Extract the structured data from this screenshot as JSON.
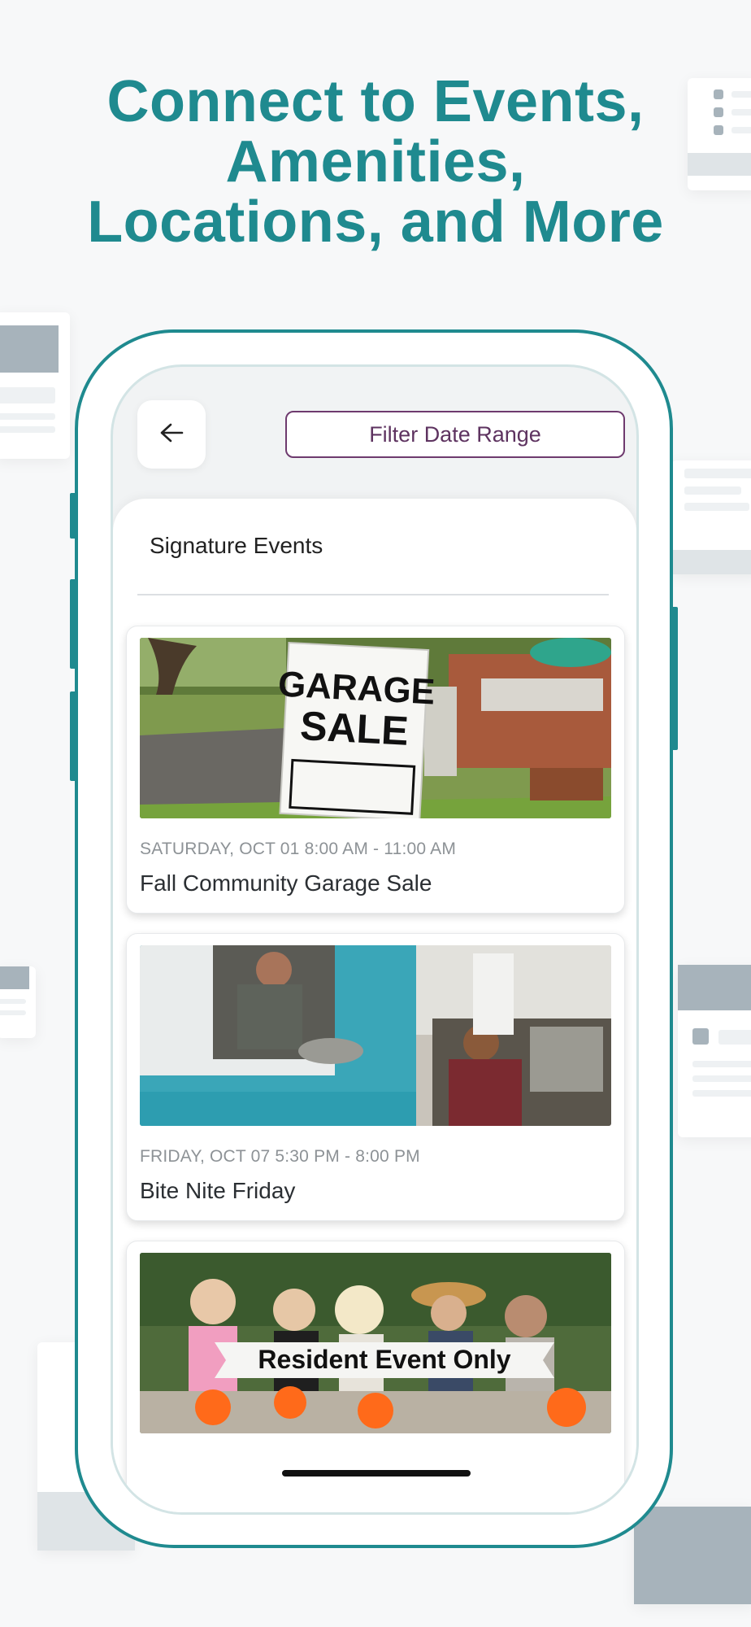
{
  "headline": {
    "line1": "Connect to Events,",
    "line2": "Amenities,",
    "line3": "Locations, and More"
  },
  "colors": {
    "brand_teal": "#1f8a8f",
    "filter_purple": "#6e3a6e"
  },
  "app": {
    "back_icon": "arrow-left-icon",
    "filter_label": "Filter Date Range",
    "section_title": "Signature Events",
    "events": [
      {
        "date": "SATURDAY, OCT 01 8:00 AM - 11:00 AM",
        "title": "Fall Community Garage Sale",
        "image_sign_line1": "GARAGE",
        "image_sign_line2": "SALE"
      },
      {
        "date": "FRIDAY, OCT 07 5:30 PM - 8:00 PM",
        "title": "Bite Nite Friday"
      },
      {
        "banner": "Resident Event Only"
      }
    ]
  }
}
